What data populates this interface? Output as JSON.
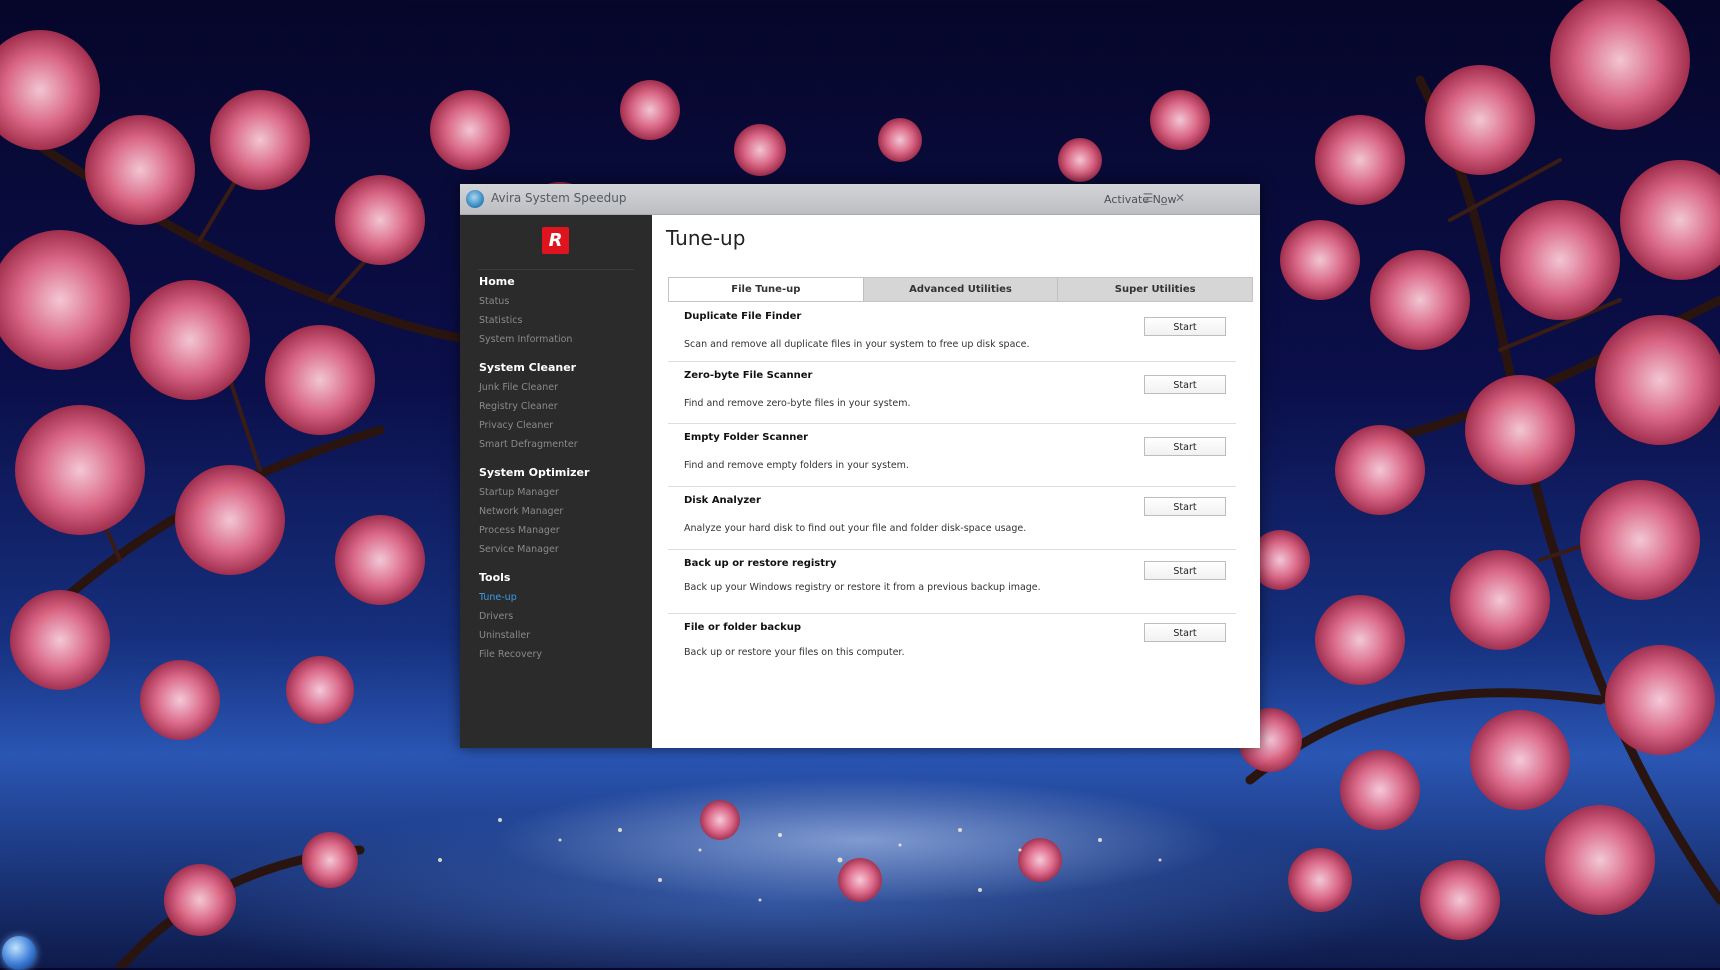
{
  "window": {
    "title": "Avira System Speedup",
    "activate_label": "Activate Now",
    "menu_icon": "menu-icon",
    "minimize_icon": "minimize-icon",
    "close_icon": "close-icon"
  },
  "sidebar": {
    "logo_letter": "R",
    "sections": [
      {
        "header": "Home",
        "items": [
          "Status",
          "Statistics",
          "System Information"
        ]
      },
      {
        "header": "System Cleaner",
        "items": [
          "Junk File Cleaner",
          "Registry Cleaner",
          "Privacy Cleaner",
          "Smart Defragmenter"
        ]
      },
      {
        "header": "System Optimizer",
        "items": [
          "Startup Manager",
          "Network Manager",
          "Process Manager",
          "Service Manager"
        ]
      },
      {
        "header": "Tools",
        "items": [
          "Tune-up",
          "Drivers",
          "Uninstaller",
          "File Recovery"
        ]
      }
    ],
    "active_item": "Tune-up"
  },
  "main": {
    "title": "Tune-up",
    "tabs": [
      {
        "label": "File Tune-up",
        "active": true
      },
      {
        "label": "Advanced Utilities",
        "active": false
      },
      {
        "label": "Super Utilities",
        "active": false
      }
    ],
    "tools": [
      {
        "title": "Duplicate File Finder",
        "description": "Scan and remove all duplicate files in your system to free up disk space.",
        "button": "Start"
      },
      {
        "title": "Zero-byte File Scanner",
        "description": "Find and remove zero-byte files in your system.",
        "button": "Start"
      },
      {
        "title": "Empty Folder Scanner",
        "description": "Find and remove empty folders in your system.",
        "button": "Start"
      },
      {
        "title": "Disk Analyzer",
        "description": "Analyze your hard disk to find out your file and folder disk-space usage.",
        "button": "Start"
      },
      {
        "title": "Back up or restore registry",
        "description": "Back up your Windows registry or restore it from a previous backup image.",
        "button": "Start"
      },
      {
        "title": "File or folder backup",
        "description": "Back up or restore your files on this computer.",
        "button": "Start"
      }
    ]
  },
  "colors": {
    "accent_red": "#e0141e",
    "active_link": "#3c9bea",
    "sidebar_bg": "#2b2b2b"
  }
}
